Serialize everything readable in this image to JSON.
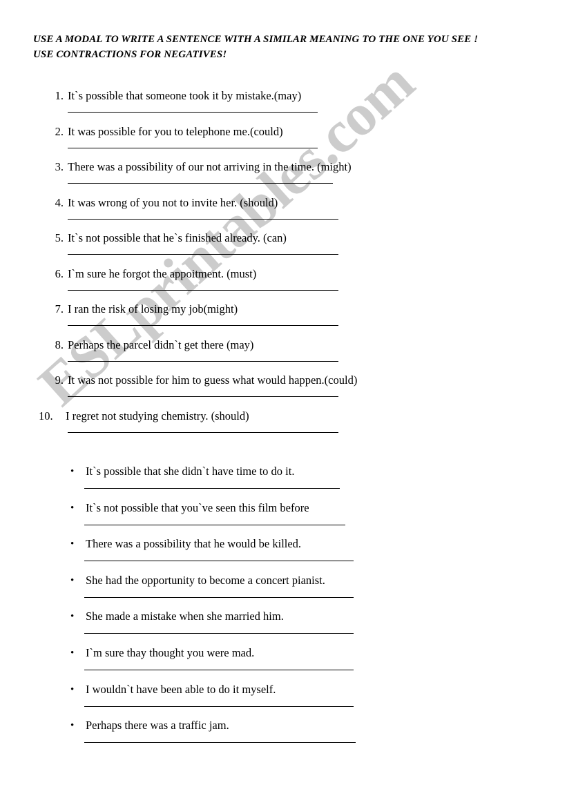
{
  "heading": {
    "line1": "USE A MODAL TO WRITE A SENTENCE WITH A SIMILAR MEANING TO THE ONE YOU SEE !",
    "line2": "USE CONTRACTIONS FOR NEGATIVES!"
  },
  "watermark": {
    "text": "ESLprintables.com",
    "color": "#cccccc"
  },
  "numbered_exercises": [
    {
      "number": "1.",
      "sentence": "It`s possible that someone took it by mistake.(may)",
      "rule_width": 362
    },
    {
      "number": "2.",
      "sentence": "It was possible for you to telephone me.(could)",
      "rule_width": 362
    },
    {
      "number": "3.",
      "sentence": "There was a possibility of our not arriving in the time. (might)",
      "rule_width": 384
    },
    {
      "number": "4.",
      "sentence": "It was wrong of you not to invite her. (should)",
      "rule_width": 392
    },
    {
      "number": "5.",
      "sentence": "It`s not possible that he`s finished already. (can)",
      "rule_width": 392
    },
    {
      "number": "6.",
      "sentence": "I`m sure he forgot the appoitment. (must)",
      "rule_width": 392
    },
    {
      "number": "7.",
      "sentence": "I ran the risk of losing my job(might)",
      "rule_width": 392
    },
    {
      "number": "8.",
      "sentence": "Perhaps the parcel didn`t get there (may)",
      "rule_width": 392
    },
    {
      "number": "9.",
      "sentence": "It was not possible for him to guess what would happen.(could)",
      "rule_width": 392
    },
    {
      "number": "10.",
      "sentence": "I regret not studying chemistry.  (should)",
      "rule_width": 392
    }
  ],
  "bulleted_exercises": [
    {
      "bullet": "•",
      "sentence": "It`s possible that she didn`t have time to do it.",
      "rule_width": 370
    },
    {
      "bullet": "•",
      "sentence": "It`s not possible that you`ve seen this film before",
      "rule_width": 378
    },
    {
      "bullet": "•",
      "sentence": "There was a possibility that he would be killed.",
      "rule_width": 390
    },
    {
      "bullet": "•",
      "sentence": "She had the opportunity to become a concert pianist.",
      "rule_width": 390
    },
    {
      "bullet": "•",
      "sentence": "She made a mistake when she married him.",
      "rule_width": 390
    },
    {
      "bullet": "•",
      "sentence": "I`m sure thay thought you were mad.",
      "rule_width": 390
    },
    {
      "bullet": "•",
      "sentence": "I wouldn`t have been able to do it myself.",
      "rule_width": 390
    },
    {
      "bullet": "•",
      "sentence": "Perhaps there was a traffic jam.",
      "rule_width": 393
    }
  ]
}
